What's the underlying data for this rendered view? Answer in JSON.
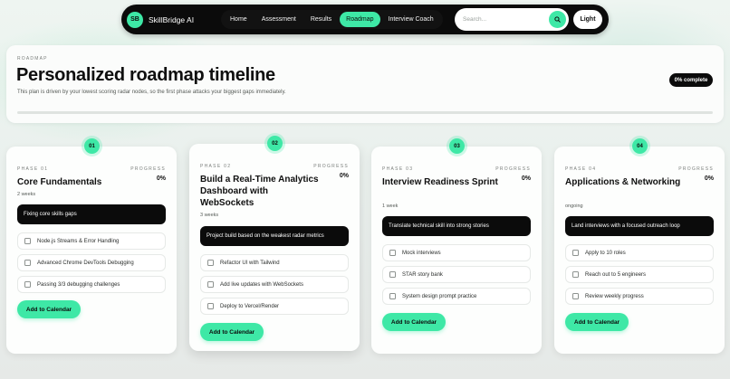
{
  "nav": {
    "brand_initials": "SB",
    "brand_name": "SkillBridge AI",
    "links": [
      "Home",
      "Assessment",
      "Results",
      "Roadmap",
      "Interview Coach"
    ],
    "active_link": "Roadmap",
    "search_placeholder": "Search...",
    "search_icon": "search-icon",
    "theme_label": "Light"
  },
  "header": {
    "eyebrow": "ROADMAP",
    "title": "Personalized roadmap timeline",
    "subtitle": "This plan is driven by your lowest scoring radar nodes, so the first phase attacks your biggest gaps immediately.",
    "progress_label": "0% complete",
    "progress_fraction": 0
  },
  "phases": [
    {
      "badge": "01",
      "label": "PHASE 01",
      "progress_label": "PROGRESS",
      "percent": "0%",
      "title": "Core Fundamentals",
      "duration": "2 weeks",
      "focus": "Fixing core skills gaps",
      "tasks": [
        "Node.js Streams & Error Handling",
        "Advanced Chrome DevTools Debugging",
        "Passing 3/3 debugging challenges"
      ],
      "button": "Add to Calendar"
    },
    {
      "badge": "02",
      "label": "PHASE 02",
      "progress_label": "PROGRESS",
      "percent": "0%",
      "title": "Build a Real-Time Analytics Dashboard with WebSockets",
      "duration": "3 weeks",
      "focus": "Project build based on the weakest radar metrics",
      "tasks": [
        "Refactor UI with Tailwind",
        "Add live updates with WebSockets",
        "Deploy to Vercel/Render"
      ],
      "button": "Add to Calendar"
    },
    {
      "badge": "03",
      "label": "PHASE 03",
      "progress_label": "PROGRESS",
      "percent": "0%",
      "title": "Interview Readiness Sprint",
      "duration": "1 week",
      "focus": "Translate technical skill into strong stories",
      "tasks": [
        "Mock interviews",
        "STAR story bank",
        "System design prompt practice"
      ],
      "button": "Add to Calendar"
    },
    {
      "badge": "04",
      "label": "PHASE 04",
      "progress_label": "PROGRESS",
      "percent": "0%",
      "title": "Applications & Networking",
      "duration": "ongoing",
      "focus": "Land interviews with a focused outreach loop",
      "tasks": [
        "Apply to 10 roles",
        "Reach out to 5 engineers",
        "Review weekly progress"
      ],
      "button": "Add to Calendar"
    }
  ],
  "colors": {
    "accent": "#3ee8a6",
    "dark": "#0b0b0b"
  }
}
